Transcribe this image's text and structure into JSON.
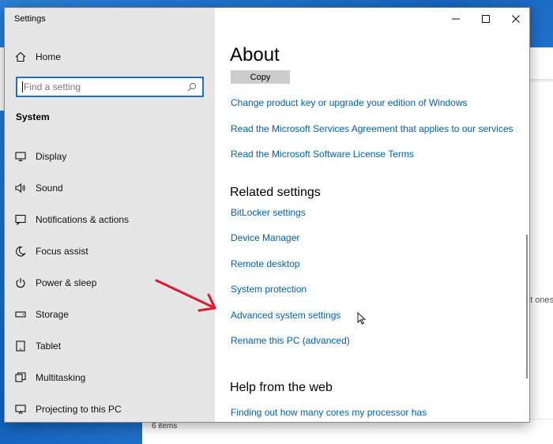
{
  "window": {
    "title": "Settings"
  },
  "sidebar": {
    "home_label": "Home",
    "search_placeholder": "Find a setting",
    "section_title": "System",
    "items": [
      {
        "label": "Display",
        "icon": "display-icon"
      },
      {
        "label": "Sound",
        "icon": "sound-icon"
      },
      {
        "label": "Notifications & actions",
        "icon": "notifications-icon"
      },
      {
        "label": "Focus assist",
        "icon": "focus-assist-icon"
      },
      {
        "label": "Power & sleep",
        "icon": "power-icon"
      },
      {
        "label": "Storage",
        "icon": "storage-icon"
      },
      {
        "label": "Tablet",
        "icon": "tablet-icon"
      },
      {
        "label": "Multitasking",
        "icon": "multitasking-icon"
      },
      {
        "label": "Projecting to this PC",
        "icon": "projecting-icon"
      }
    ]
  },
  "content": {
    "title": "About",
    "copy_button": "Copy",
    "links_top": [
      "Change product key or upgrade your edition of Windows",
      "Read the Microsoft Services Agreement that applies to our services",
      "Read the Microsoft Software License Terms"
    ],
    "related_heading": "Related settings",
    "related_links": [
      "BitLocker settings",
      "Device Manager",
      "Remote desktop",
      "System protection",
      "Advanced system settings",
      "Rename this PC (advanced)"
    ],
    "help_heading": "Help from the web",
    "help_links": [
      "Finding out how many cores my processor has"
    ]
  },
  "background": {
    "status_text": "6 items",
    "side_text": "nt ones"
  },
  "colors": {
    "link": "#0063b1",
    "accent": "#1f6fc4",
    "arrow": "#e0192a",
    "sidebar_bg": "#e6e6e6"
  }
}
